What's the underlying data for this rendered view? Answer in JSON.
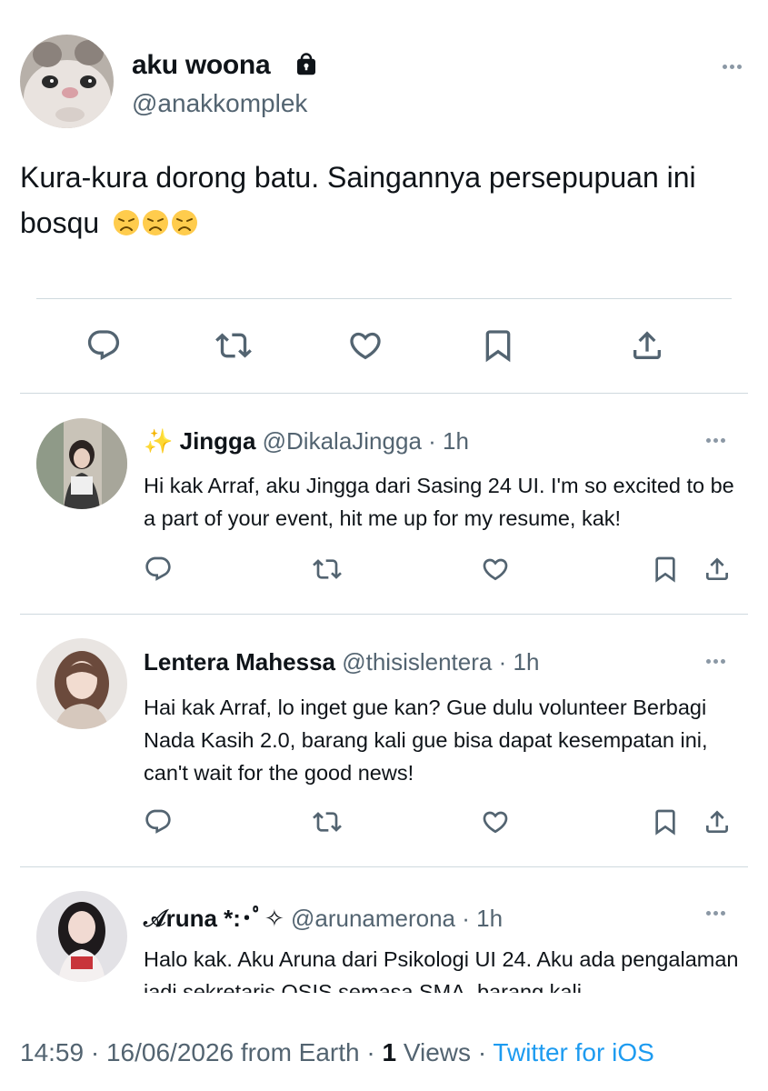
{
  "main_tweet": {
    "display_name": "aku woona",
    "handle": "@anakkomplek",
    "text": "Kura-kura dorong batu. Saingannya persepupuan ini bosqu",
    "emoji": [
      "disappointed-face",
      "disappointed-face",
      "disappointed-face"
    ],
    "icons": {
      "lock": "lock-icon",
      "more": "more-icon"
    }
  },
  "actions": [
    "reply-icon",
    "retweet-icon",
    "like-icon",
    "bookmark-icon",
    "share-icon"
  ],
  "replies": [
    {
      "prefix": "✨",
      "display_name": "Jingga",
      "handle": "@DikalaJingga",
      "time": "1h",
      "text": "Hi kak Arraf, aku Jingga dari Sasing 24 UI. I'm so excited to be a part of your event, hit me up for my resume, kak!"
    },
    {
      "prefix": "",
      "display_name": "Lentera Mahessa",
      "handle": "@thisislentera",
      "time": "1h",
      "text": "Hai kak Arraf, lo inget gue kan? Gue dulu volunteer Berbagi Nada Kasih 2.0, barang kali gue bisa dapat kesempatan ini, can't wait for the good news!"
    },
    {
      "prefix": "",
      "display_name": "𝒜runa *:･ﾟ✧",
      "handle": "@arunamerona",
      "time": "1h",
      "text": "Halo kak. Aku Aruna dari Psikologi UI 24. Aku ada pengalaman jadi sekretaris OSIS semasa SMA, barang kali"
    }
  ],
  "separator": "·",
  "footer": {
    "time": "14:59",
    "date": "16/06/2026",
    "location": "from Earth",
    "views_count": "1",
    "views_label": "Views",
    "source": "Twitter for iOS"
  },
  "colors": {
    "text": "#0f1419",
    "secondary": "#536471",
    "icon": "#536471",
    "link": "#1d9bf0",
    "divider": "#cfd9de"
  }
}
